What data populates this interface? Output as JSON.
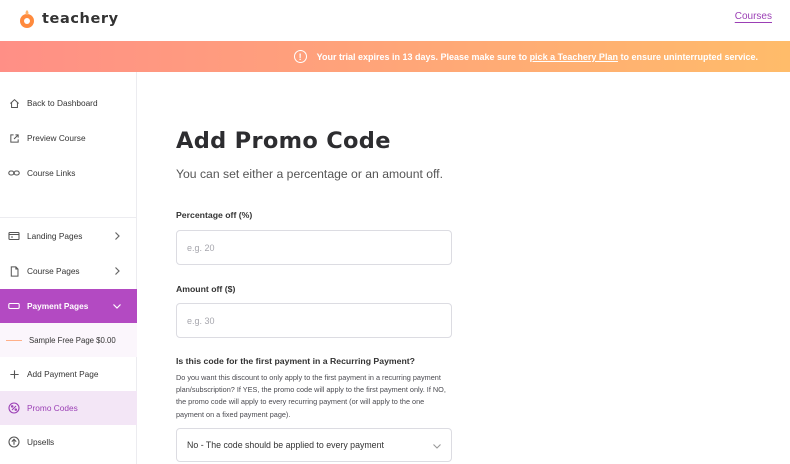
{
  "header": {
    "brand_name": "teachery",
    "nav_link": "Courses",
    "brand_color": "#ff8a3d",
    "accent_color": "#9b3fb5"
  },
  "banner": {
    "icon": "info-icon",
    "text_before": "Your trial expires in 13 days. Please make sure to ",
    "link_text": "pick a Teachery Plan",
    "text_after": " to ensure uninterrupted service."
  },
  "sidebar": {
    "items": [
      {
        "label": "Back to Dashboard",
        "icon": "home-icon"
      },
      {
        "label": "Preview Course",
        "icon": "external-link-icon"
      },
      {
        "label": "Course Links",
        "icon": "link-icon"
      },
      {
        "label": "Landing Pages",
        "icon": "landing-page-icon"
      },
      {
        "label": "Course Pages",
        "icon": "document-icon"
      },
      {
        "label": "Payment Pages",
        "icon": "payment-icon"
      },
      {
        "label": "Sample Free Page $0.00",
        "icon": "dash-icon"
      },
      {
        "label": "Add Payment Page",
        "icon": "plus-icon"
      },
      {
        "label": "Promo Codes",
        "icon": "percent-icon"
      },
      {
        "label": "Upsells",
        "icon": "upsell-icon"
      }
    ]
  },
  "main": {
    "title": "Add Promo Code",
    "subtitle": "You can set either a percentage or an amount off.",
    "percentage_label": "Percentage off (%)",
    "percentage_placeholder": "e.g. 20",
    "amount_label": "Amount off ($)",
    "amount_placeholder": "e.g. 30",
    "recurring_label": "Is this code for the first payment in a Recurring Payment?",
    "recurring_help": "Do you want this discount to only apply to the first payment in a recurring payment plan/subscription? If YES, the promo code will apply to the first payment only. If NO, the promo code will apply to every recurring payment (or will apply to the one payment on a fixed payment page).",
    "recurring_select_value": "No - The code should be applied to every payment"
  }
}
